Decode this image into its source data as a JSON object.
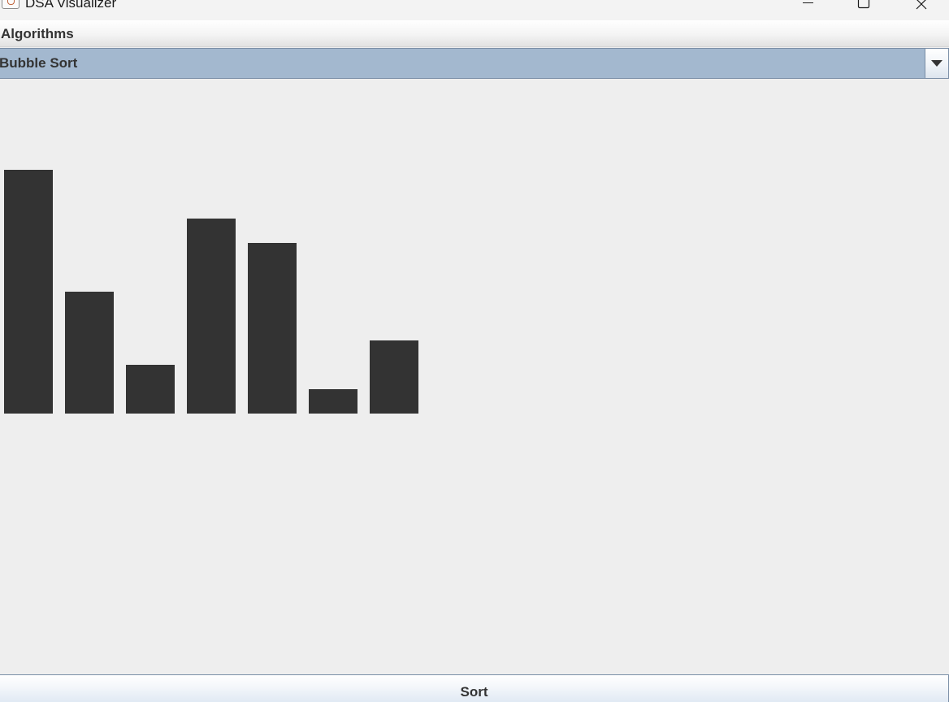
{
  "window": {
    "title": "DSA Visualizer",
    "icon": "java-cup-icon",
    "controls": [
      "minimize-icon",
      "maximize-icon",
      "close-icon"
    ]
  },
  "menubar": {
    "items": [
      {
        "label": "Algorithms"
      }
    ]
  },
  "algorithm_select": {
    "selected": "Bubble Sort",
    "arrow_icon": "chevron-down-icon"
  },
  "visualizer": {
    "bar_color": "#333333",
    "array_values": [
      10,
      5,
      2,
      8,
      7,
      1,
      3
    ]
  },
  "actions": {
    "sort_label": "Sort"
  },
  "colors": {
    "background": "#eeeeee",
    "combo_selection": "#a3b8cf",
    "bar": "#333333"
  }
}
